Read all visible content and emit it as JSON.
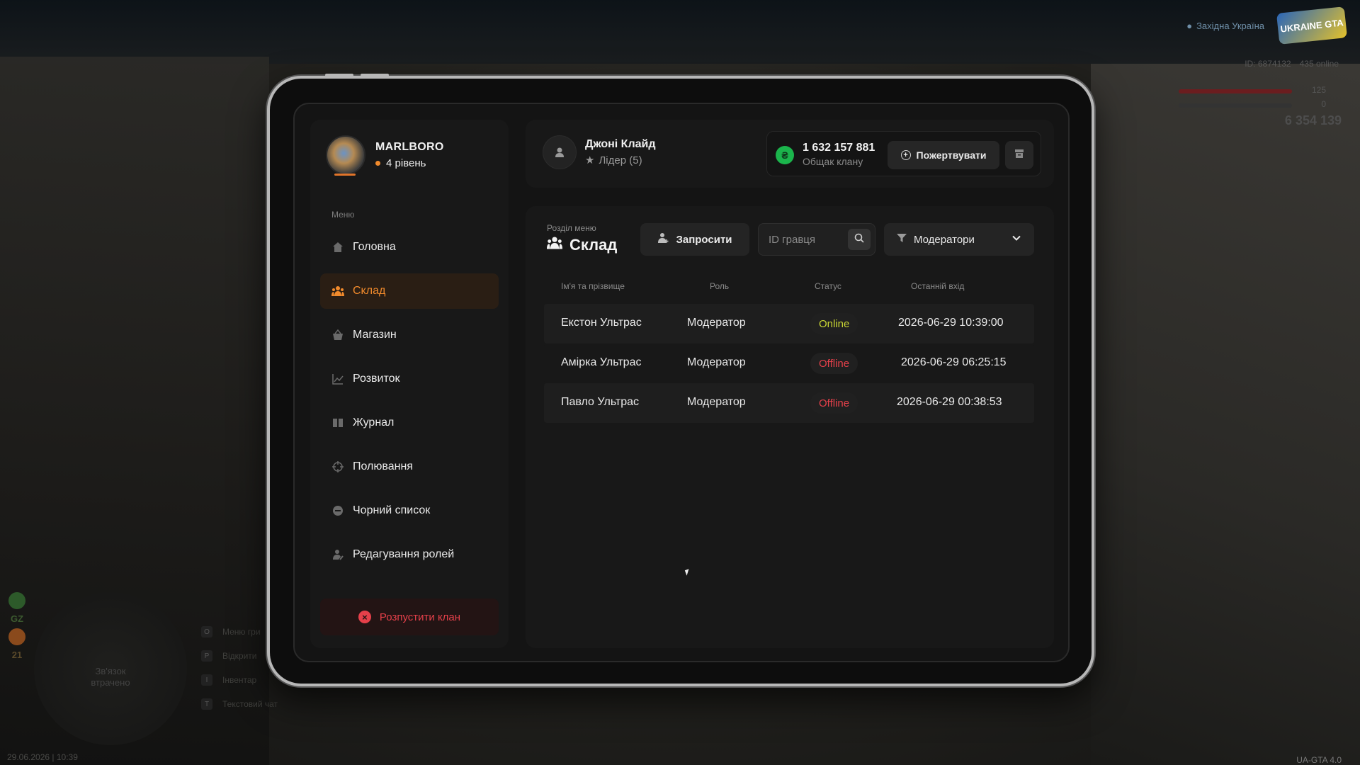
{
  "hud": {
    "region": "Західна Україна",
    "logo": "UKRAINE GTA",
    "id_text": "ID: 6874132",
    "online_text": "435 online",
    "health": "125",
    "armor": "0",
    "money": "6 354 139",
    "gz_label": "GZ",
    "wanted": "21",
    "minimap_text": "Зв'язок втрачено",
    "keys": [
      {
        "key": "O",
        "label": "Меню гри"
      },
      {
        "key": "P",
        "label": "Відкрити"
      },
      {
        "key": "I",
        "label": "Інвентар"
      },
      {
        "key": "T",
        "label": "Текстовий чат"
      }
    ],
    "datetime": "29.06.2026 | 10:39",
    "version": "UA-GTA 4.0"
  },
  "sidebar": {
    "clan_name": "MARLBORO",
    "clan_level": "4 рівень",
    "menu_caption": "Меню",
    "items": [
      {
        "label": "Головна",
        "icon": "home-icon",
        "active": false
      },
      {
        "label": "Склад",
        "icon": "people-icon",
        "active": true
      },
      {
        "label": "Магазин",
        "icon": "basket-icon",
        "active": false
      },
      {
        "label": "Розвиток",
        "icon": "chart-icon",
        "active": false
      },
      {
        "label": "Журнал",
        "icon": "book-icon",
        "active": false
      },
      {
        "label": "Полювання",
        "icon": "crosshair-icon",
        "active": false
      },
      {
        "label": "Чорний список",
        "icon": "block-icon",
        "active": false
      },
      {
        "label": "Редагування ролей",
        "icon": "user-edit-icon",
        "active": false
      }
    ],
    "disband_label": "Розпустити клан"
  },
  "header": {
    "leader_name": "Джоні Клайд",
    "leader_role": "Лідер (5)",
    "bank_sum": "1 632 157 881",
    "bank_label": "Общак клану",
    "donate_label": "Пожертвувати"
  },
  "main": {
    "section_caption": "Розділ меню",
    "section_title": "Склад",
    "invite_label": "Запросити",
    "search_placeholder": "ID гравця",
    "filter_label": "Модератори",
    "columns": [
      "Ім'я та прізвище",
      "Роль",
      "Статус",
      "Останній вхід"
    ],
    "rows": [
      {
        "name": "Екстон Ультрас",
        "role": "Модератор",
        "status": "Online",
        "last_login": "2026-06-29 10:39:00"
      },
      {
        "name": "Амірка Ультрас",
        "role": "Модератор",
        "status": "Offline",
        "last_login": "2026-06-29 06:25:15"
      },
      {
        "name": "Павло Ультрас",
        "role": "Модератор",
        "status": "Offline",
        "last_login": "2026-06-29 00:38:53"
      }
    ]
  },
  "colors": {
    "accent": "#f08a2c",
    "online": "#c9d534",
    "offline": "#e5404a",
    "coin": "#1bb54c"
  }
}
